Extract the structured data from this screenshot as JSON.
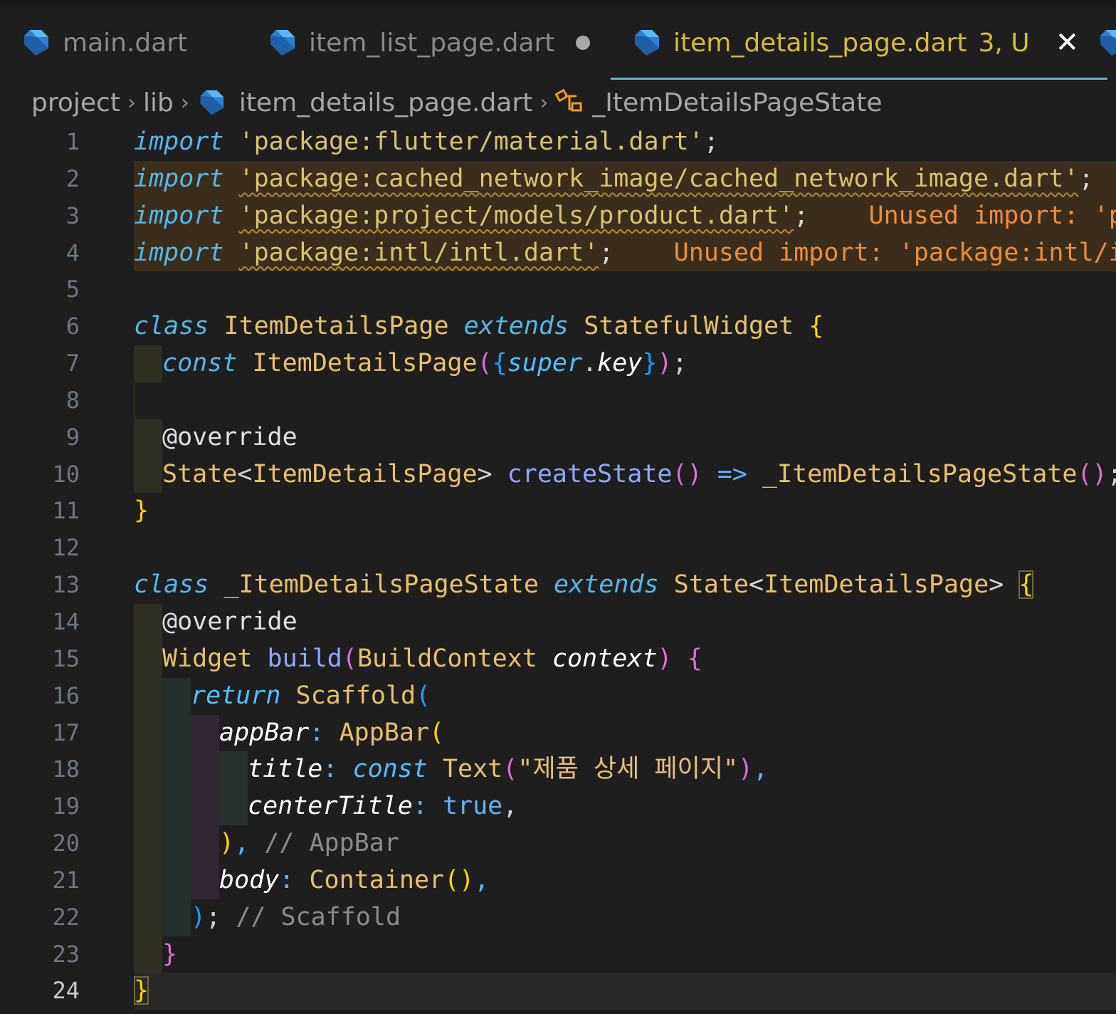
{
  "tabs": [
    {
      "label": "main.dart",
      "icon": "dart-file-icon",
      "state": "inactive"
    },
    {
      "label": "item_list_page.dart",
      "icon": "dart-file-icon",
      "state": "modified"
    },
    {
      "label": "item_details_page.dart",
      "icon": "dart-file-icon",
      "state": "active",
      "status": "3, U",
      "close": "✕"
    }
  ],
  "breadcrumb": {
    "items": [
      "project",
      "lib",
      "item_details_page.dart",
      "_ItemDetailsPageState"
    ],
    "separator": "›",
    "file_icon": "dart-file-icon",
    "symbol_icon": "class-symbol-icon"
  },
  "editor": {
    "line_numbers": [
      "1",
      "2",
      "3",
      "4",
      "5",
      "6",
      "7",
      "8",
      "9",
      "10",
      "11",
      "12",
      "13",
      "14",
      "15",
      "16",
      "17",
      "18",
      "19",
      "20",
      "21",
      "22",
      "23",
      "24"
    ],
    "current_line": "24",
    "tokens": {
      "import": "import",
      "class": "class",
      "extends": "extends",
      "const": "const",
      "super": "super",
      "key": "key",
      "override": "@override",
      "return": "return",
      "true": "true",
      "l1_str": "'package:flutter/material.dart'",
      "l2_str": "'package:cached_network_image/cached_network_image.dart'",
      "l3_str": "'package:project/models/product.dart'",
      "l3_warn": "Unused import: 'pa",
      "l4_str": "'package:intl/intl.dart'",
      "l4_warn": "Unused import: 'package:intl/in",
      "ItemDetailsPage": "ItemDetailsPage",
      "StatefulWidget": "StatefulWidget",
      "State": "State",
      "createState": "createState",
      "ItemDetailsPageState": "_ItemDetailsPageState",
      "Widget": "Widget",
      "build": "build",
      "BuildContext": "BuildContext",
      "context": "context",
      "Scaffold": "Scaffold",
      "appBar": "appBar",
      "AppBar": "AppBar",
      "title": "title",
      "Text": "Text",
      "text_value": "\"제품 상세 페이지\"",
      "centerTitle": "centerTitle",
      "cmt_appbar": "// AppBar",
      "body": "body",
      "Container": "Container",
      "cmt_scaffold": "// Scaffold"
    }
  },
  "colors": {
    "background": "#1e1e1e",
    "active_tab_text": "#d7ba3c",
    "tab_underline": "#5fb9c8",
    "warning_text": "#f08c3a"
  }
}
